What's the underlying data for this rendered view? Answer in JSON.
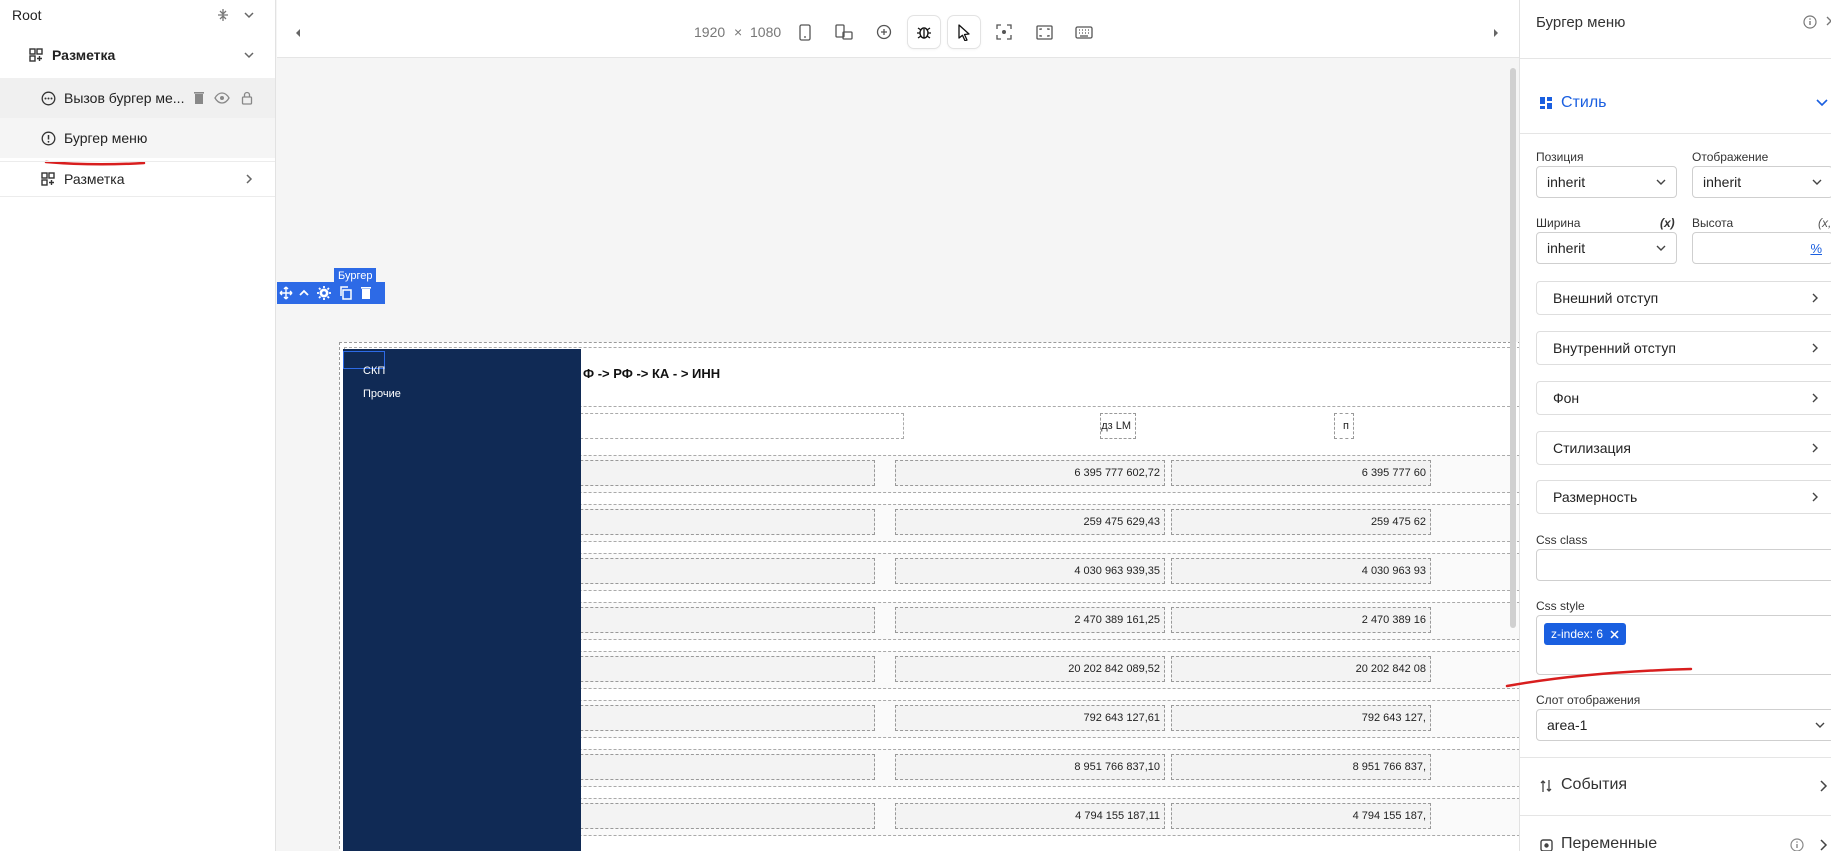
{
  "tree": {
    "root_label": "Root",
    "items": [
      {
        "label": "Разметка"
      },
      {
        "label": "Вызов бургер ме..."
      },
      {
        "label": "Бургер меню"
      },
      {
        "label": "Разметка"
      }
    ]
  },
  "toolbar": {
    "width": "1920",
    "times": "×",
    "height": "1080"
  },
  "canvas": {
    "selected_tag": "Бургер",
    "menu_items": [
      "СКП",
      "Прочие"
    ],
    "breadcrumb": "Ф -> РФ -> КА - > ИНН",
    "header_cells": [
      "пдз LM",
      "п"
    ],
    "rows": [
      {
        "v1": "6 395 777 602,72",
        "v2": "6 395 777 60"
      },
      {
        "v1": "259 475 629,43",
        "v2": "259 475 62"
      },
      {
        "v1": "4 030 963 939,35",
        "v2": "4 030 963 93"
      },
      {
        "v1": "2 470 389 161,25",
        "v2": "2 470 389 16"
      },
      {
        "v1": "20 202 842 089,52",
        "v2": "20 202 842 08"
      },
      {
        "v1": "792 643 127,61",
        "v2": "792 643 127,"
      },
      {
        "v1": "8 951 766 837,10",
        "v2": "8 951 766 837,"
      },
      {
        "v1": "4 794 155 187,11",
        "v2": "4 794 155 187,"
      }
    ]
  },
  "props": {
    "title": "Бургер меню",
    "style_section": "Стиль",
    "position_label": "Позиция",
    "position_value": "inherit",
    "display_label": "Отображение",
    "display_value": "inherit",
    "width_label": "Ширина",
    "width_value": "inherit",
    "height_label": "Высота",
    "var_marker": "(x)",
    "var_marker_cut": "(x,",
    "percent": "%",
    "sections": [
      "Внешний отступ",
      "Внутренний отступ",
      "Фон",
      "Стилизация",
      "Размерность"
    ],
    "css_class_label": "Css class",
    "css_style_label": "Css style",
    "css_style_chip": "z-index: 6",
    "slot_label": "Слот отображения",
    "slot_value": "area-1",
    "events_label": "События",
    "variables_label": "Переменные"
  },
  "colors": {
    "accent": "#1a5fe0",
    "burger_bg": "#102a55",
    "annotation": "#d81e1e"
  }
}
